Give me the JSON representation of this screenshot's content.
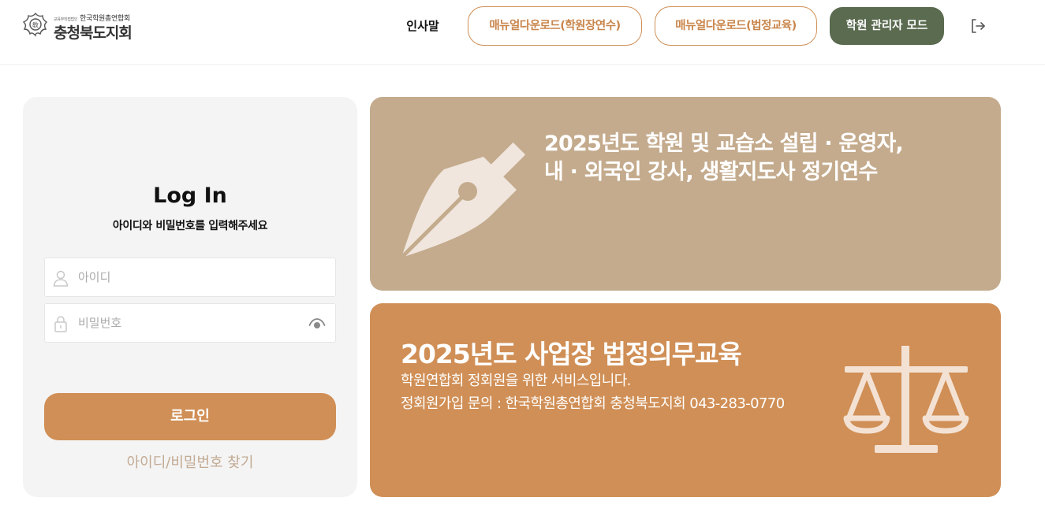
{
  "header": {
    "logo": {
      "emblem_icon": "academy-emblem-icon",
      "emblem_char": "敎",
      "tiny_text": "교육부직접법인",
      "org_name": "한국학원총연합회",
      "branch_name": "충청북도지회"
    },
    "nav": {
      "greeting": "인사말",
      "manual_academy": "매뉴얼다운로드(학원장연수)",
      "manual_legal": "매뉴얼다운로드(법정교육)",
      "admin_mode": "학원 관리자 모드",
      "logout_icon": "logout-icon"
    }
  },
  "login": {
    "title": "Log In",
    "subtitle": "아이디와 비밀번호를 입력해주세요",
    "id_placeholder": "아이디",
    "id_value": "",
    "pw_placeholder": "비밀번호",
    "pw_value": "",
    "user_icon": "user-icon",
    "lock_icon": "lock-icon",
    "eye_icon": "eye-icon",
    "submit_label": "로그인",
    "find_link": "아이디/비밀번호 찾기"
  },
  "banners": {
    "training": {
      "icon": "fountain-pen-icon",
      "title_line1": "2025년도 학원 및 교습소 설립 · 운영자,",
      "title_line2": "내 · 외국인 강사, 생활지도사 정기연수"
    },
    "legal_education": {
      "icon": "scale-icon",
      "title": "2025년도 사업장 법정의무교육",
      "line1": "학원연합회 정회원을 위한 서비스입니다.",
      "line2": "정회원가입 문의 : 한국학원총연합회 충청북도지회 043-283-0770"
    }
  },
  "colors": {
    "accent_orange": "#d08f56",
    "banner_tan": "#c4ab8d",
    "admin_green": "#5a6b50",
    "panel_gray": "#f4f4f4",
    "link_tan": "#c2aa93"
  }
}
